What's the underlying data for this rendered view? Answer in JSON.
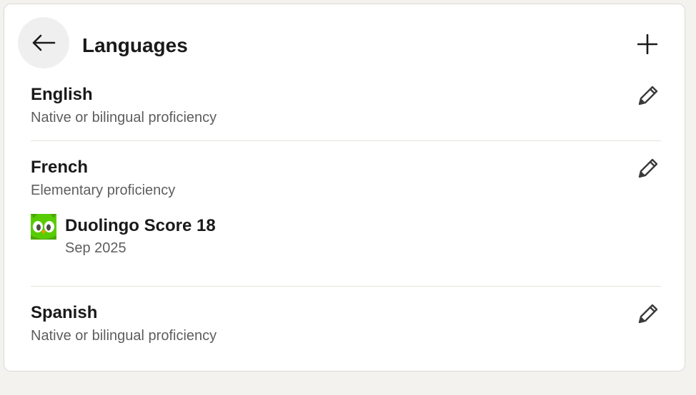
{
  "header": {
    "title": "Languages",
    "back_icon": "arrow-left-icon",
    "add_icon": "plus-icon"
  },
  "languages": [
    {
      "name": "English",
      "proficiency": "Native or bilingual proficiency",
      "edit_icon": "pencil-icon"
    },
    {
      "name": "French",
      "proficiency": "Elementary proficiency",
      "edit_icon": "pencil-icon",
      "certification": {
        "name": "Duolingo Score 18",
        "date": "Sep 2025",
        "logo_icon": "duolingo-logo-icon"
      }
    },
    {
      "name": "Spanish",
      "proficiency": "Native or bilingual proficiency",
      "edit_icon": "pencil-icon"
    }
  ],
  "colors": {
    "page_background": "#f4f2ee",
    "card_background": "#ffffff",
    "primary_text": "#1a1a1a",
    "secondary_text": "#5e5e5e",
    "divider": "#e4e2de",
    "back_button_background": "#efefef",
    "duolingo_green": "#58cc02"
  }
}
